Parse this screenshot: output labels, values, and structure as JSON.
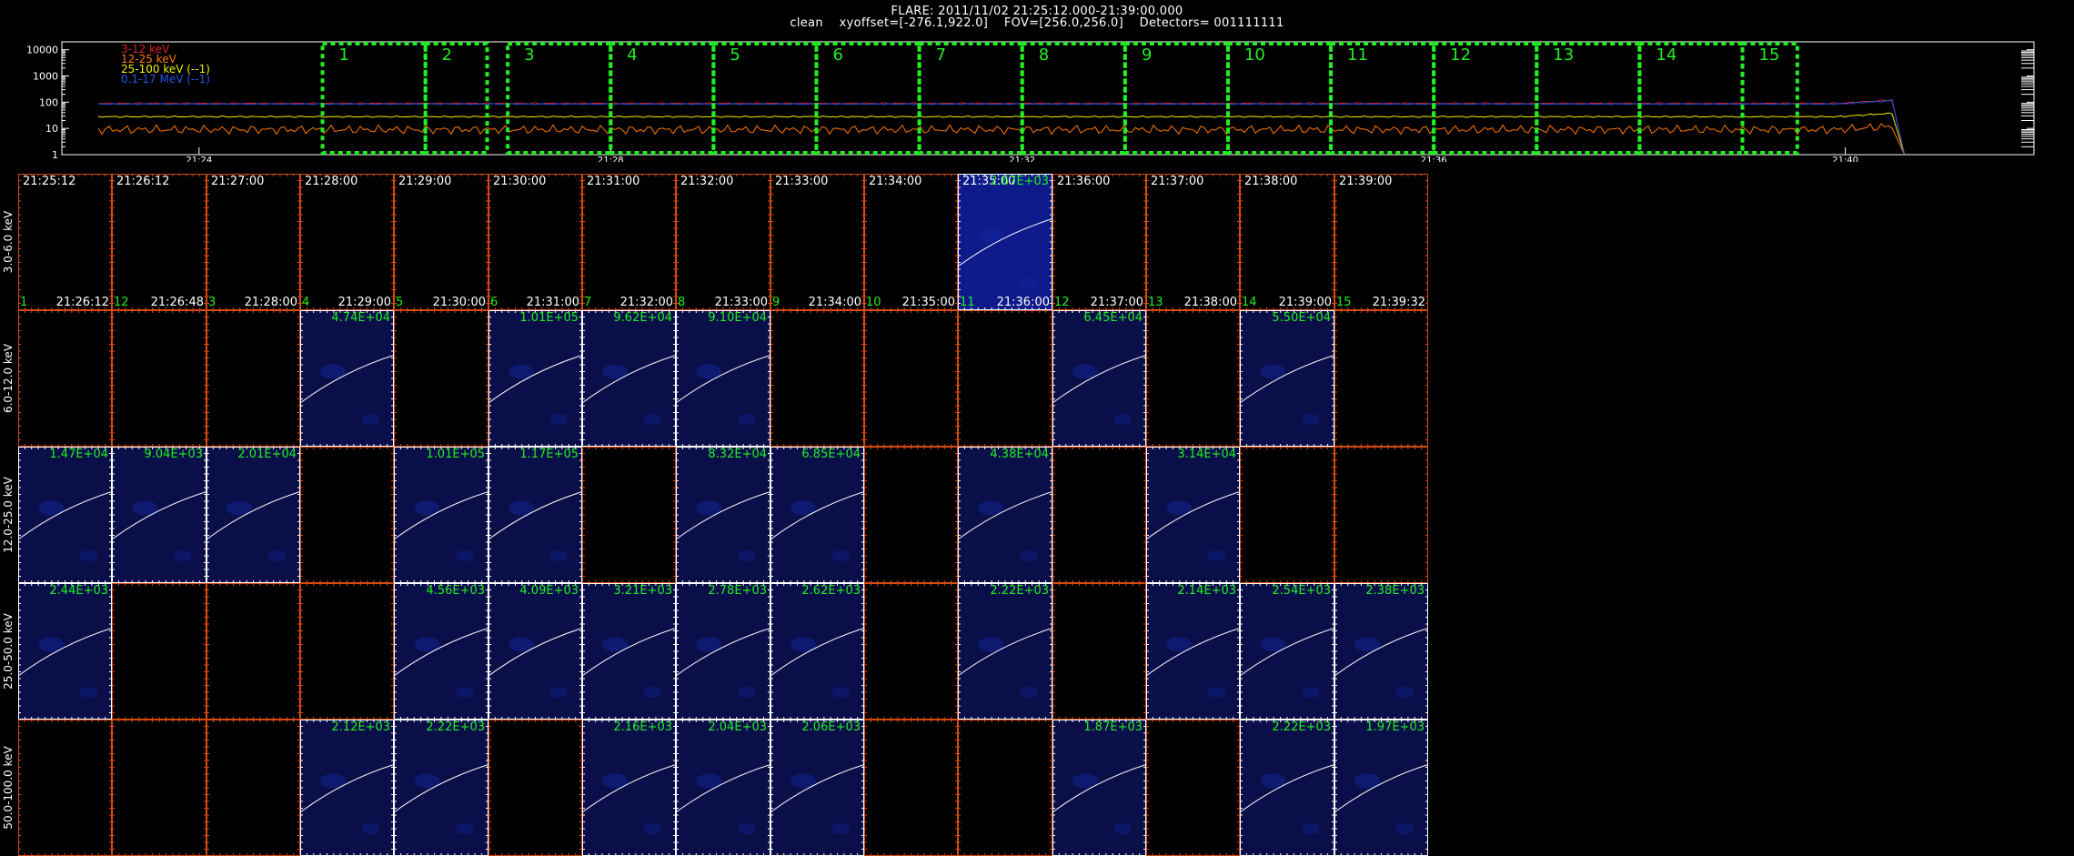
{
  "header": {
    "title": "FLARE: 2011/11/02 21:25:12.000-21:39:00.000",
    "params": "clean    xyoffset=[-276.1,922.0]    FOV=[256.0,256.0]    Detectors= 001111111"
  },
  "lightcurve": {
    "y_ticks": [
      "10000",
      "1000",
      "100",
      "10",
      "1"
    ],
    "x_ticks": [
      "21:24",
      "21:28",
      "21:32",
      "21:36",
      "21:40"
    ],
    "legend": [
      {
        "label": "3-12 keV",
        "color": "#dd2222"
      },
      {
        "label": "12-25 keV",
        "color": "#ff7700"
      },
      {
        "label": "25-100 keV (--1)",
        "color": "#eeee00"
      },
      {
        "label": "0.1-17 MeV (--1)",
        "color": "#2255ee"
      }
    ],
    "interval_labels": [
      "1",
      "2",
      "3",
      "4",
      "5",
      "6",
      "7",
      "8",
      "9",
      "10",
      "11",
      "12",
      "13",
      "14",
      "15"
    ]
  },
  "chart_data": {
    "type": "line",
    "title": "FLARE: 2011/11/02 21:25:12.000-21:39:00.000",
    "y_scale": "log",
    "ylim": [
      1,
      20000
    ],
    "x_range": [
      "21:22:40",
      "21:41:50"
    ],
    "series": [
      {
        "name": "3-12 keV",
        "color": "#dd2222",
        "level": 90
      },
      {
        "name": "12-25 keV",
        "color": "#ff7700",
        "level": 9
      },
      {
        "name": "25-100 keV (--1)",
        "color": "#eeee00",
        "level": 28
      },
      {
        "name": "0.1-17 MeV (--1)",
        "color": "#2255ee",
        "level": 85
      }
    ],
    "intervals": [
      [
        "21:25:12",
        "21:26:12"
      ],
      [
        "21:26:12",
        "21:26:48"
      ],
      [
        "21:27:00",
        "21:28:00"
      ],
      [
        "21:28:00",
        "21:29:00"
      ],
      [
        "21:29:00",
        "21:30:00"
      ],
      [
        "21:30:00",
        "21:31:00"
      ],
      [
        "21:31:00",
        "21:32:00"
      ],
      [
        "21:32:00",
        "21:33:00"
      ],
      [
        "21:33:00",
        "21:34:00"
      ],
      [
        "21:34:00",
        "21:35:00"
      ],
      [
        "21:35:00",
        "21:36:00"
      ],
      [
        "21:36:00",
        "21:37:00"
      ],
      [
        "21:37:00",
        "21:38:00"
      ],
      [
        "21:38:00",
        "21:39:00"
      ],
      [
        "21:39:00",
        "21:39:32"
      ]
    ]
  },
  "image_grid": {
    "energy_bands": [
      "3.0-6.0 keV",
      "6.0-12.0 keV",
      "12.0-25.0 keV",
      "25.0-50.0 keV",
      "50.0-100.0 keV"
    ],
    "columns": [
      {
        "start": "21:25:12",
        "end": "21:26:12",
        "index": "1"
      },
      {
        "start": "21:26:12",
        "end": "21:26:48",
        "index": "12"
      },
      {
        "start": "21:27:00",
        "end": "21:28:00",
        "index": "3"
      },
      {
        "start": "21:28:00",
        "end": "21:29:00",
        "index": "4"
      },
      {
        "start": "21:29:00",
        "end": "21:30:00",
        "index": "5"
      },
      {
        "start": "21:30:00",
        "end": "21:31:00",
        "index": "6"
      },
      {
        "start": "21:31:00",
        "end": "21:32:00",
        "index": "7"
      },
      {
        "start": "21:32:00",
        "end": "21:33:00",
        "index": "8"
      },
      {
        "start": "21:33:00",
        "end": "21:34:00",
        "index": "9"
      },
      {
        "start": "21:34:00",
        "end": "21:35:00",
        "index": "10"
      },
      {
        "start": "21:35:00",
        "end": "21:36:00",
        "index": "11"
      },
      {
        "start": "21:36:00",
        "end": "21:37:00",
        "index": "12"
      },
      {
        "start": "21:37:00",
        "end": "21:38:00",
        "index": "13"
      },
      {
        "start": "21:38:00",
        "end": "21:39:00",
        "index": "14"
      },
      {
        "start": "21:39:00",
        "end": "21:39:32",
        "index": "15"
      }
    ],
    "max_values": [
      [
        "",
        "",
        "",
        "",
        "",
        "",
        "",
        "",
        "",
        "",
        "2.67E+03",
        "",
        "",
        "",
        ""
      ],
      [
        "",
        "",
        "",
        "4.74E+04",
        "",
        "1.01E+05",
        "9.62E+04",
        "9.10E+04",
        "",
        "",
        "",
        "6.45E+04",
        "",
        "5.50E+04",
        ""
      ],
      [
        "1.47E+04",
        "9.04E+03",
        "2.01E+04",
        "",
        "1.01E+05",
        "1.17E+05",
        "",
        "8.32E+04",
        "6.85E+04",
        "",
        "4.38E+04",
        "",
        "3.14E+04",
        "",
        ""
      ],
      [
        "2.44E+03",
        "",
        "",
        "",
        "4.56E+03",
        "4.09E+03",
        "3.21E+03",
        "2.78E+03",
        "2.62E+03",
        "",
        "2.22E+03",
        "",
        "2.14E+03",
        "2.54E+03",
        "2.38E+03"
      ],
      [
        "",
        "",
        "",
        "2.12E+03",
        "2.22E+03",
        "",
        "2.16E+03",
        "2.04E+03",
        "2.06E+03",
        "",
        "",
        "1.87E+03",
        "",
        "2.22E+03",
        "1.97E+03"
      ]
    ]
  },
  "colors": {
    "axis_orange": "#d64a14",
    "axis_white": "#ffffff",
    "label_green": "#22ee22",
    "interval_green": "#22ee22",
    "image_blue": "#0a0f4a",
    "limb_white": "#ffffff"
  }
}
